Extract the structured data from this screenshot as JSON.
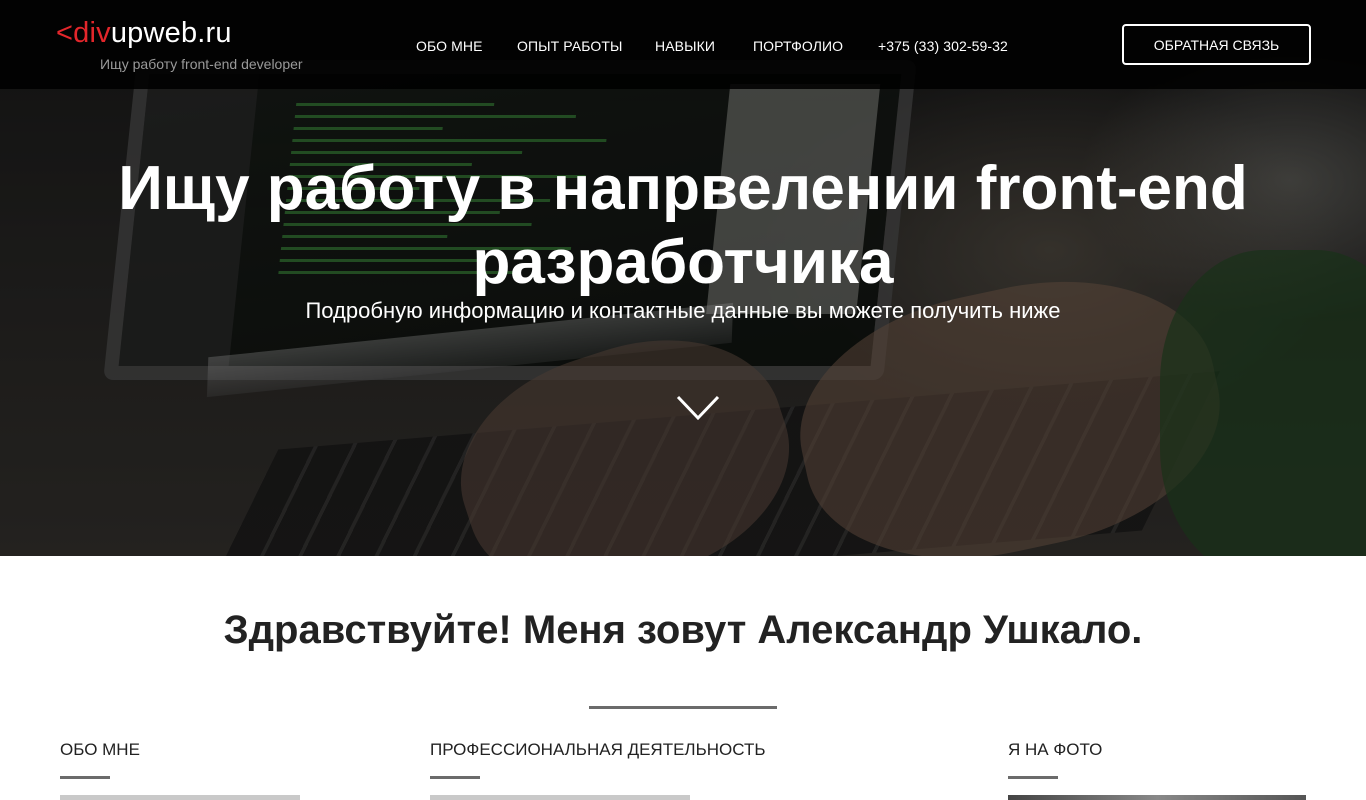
{
  "header": {
    "logo_accent": "<div",
    "logo_rest": "upweb.ru",
    "tagline": "Ищу работу front-end developer",
    "nav": [
      {
        "label": "ОБО МНЕ"
      },
      {
        "label": "ОПЫТ РАБОТЫ"
      },
      {
        "label": "НАВЫКИ"
      },
      {
        "label": "ПОРТФОЛИО"
      },
      {
        "label": "+375 (33) 302-59-32"
      }
    ],
    "feedback_button": "ОБРАТНАЯ СВЯЗЬ"
  },
  "hero": {
    "title_line1": "Ищу работу в напрвелении front-end",
    "title_line2": "разработчика",
    "subtitle": "Подробную информацию и контактные данные вы можете получить ниже",
    "scroll_icon": "chevron-down-icon"
  },
  "about": {
    "greeting": "Здравствуйте! Меня зовут Александр Ушкало.",
    "columns": [
      {
        "title": "ОБО МНЕ"
      },
      {
        "title": "ПРОФЕССИОНАЛЬНАЯ ДЕЯТЕЛЬНОСТЬ"
      },
      {
        "title": "Я НА ФОТО"
      }
    ]
  },
  "colors": {
    "accent": "#e3262b",
    "header_bg": "#000000",
    "divider": "#6b6b6b"
  }
}
